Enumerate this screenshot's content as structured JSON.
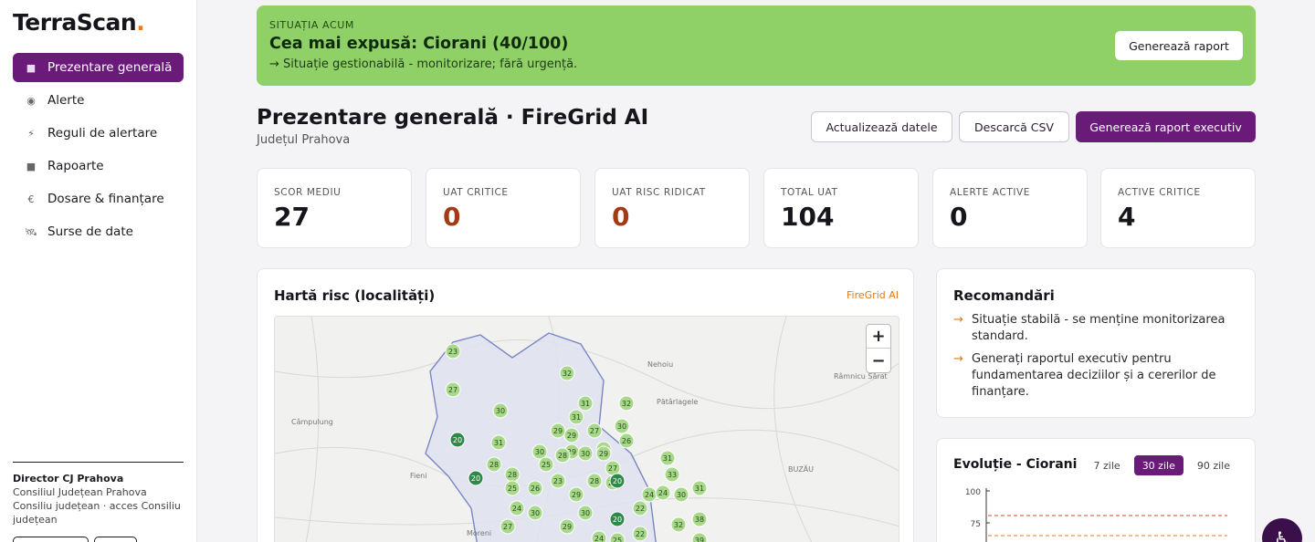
{
  "brand": {
    "name": "TerraScan",
    "dot": "."
  },
  "sidebar": {
    "items": [
      {
        "label": "Prezentare generală",
        "icon": "square-icon",
        "glyph": "■",
        "active": true
      },
      {
        "label": "Alerte",
        "icon": "alert-dot-icon",
        "glyph": "◉",
        "active": false
      },
      {
        "label": "Reguli de alertare",
        "icon": "bolt-icon",
        "glyph": "⚡",
        "active": false
      },
      {
        "label": "Rapoarte",
        "icon": "report-icon",
        "glyph": "■",
        "active": false
      },
      {
        "label": "Dosare & finanțare",
        "icon": "euro-icon",
        "glyph": "€",
        "active": false
      },
      {
        "label": "Surse de date",
        "icon": "satellite-icon",
        "glyph": "🛰",
        "active": false
      }
    ],
    "user": {
      "name": "Director CJ Prahova",
      "org": "Consiliul Județean Prahova",
      "role": "Consiliu județean · acces Consiliu județean"
    }
  },
  "banner": {
    "label": "SITUAȚIA ACUM",
    "headline": "Cea mai expusă: Ciorani (40/100)",
    "sub": "→ Situație gestionabilă - monitorizare; fără urgență.",
    "button": "Generează raport",
    "color": "#8fd166"
  },
  "header": {
    "title": "Prezentare generală · FireGrid AI",
    "subtitle": "Județul Prahova",
    "buttons": {
      "refresh": "Actualizează datele",
      "csv": "Descarcă CSV",
      "exec": "Generează raport executiv"
    }
  },
  "kpis": [
    {
      "label": "SCOR MEDIU",
      "value": "27",
      "danger": false
    },
    {
      "label": "UAT CRITICE",
      "value": "0",
      "danger": true
    },
    {
      "label": "UAT RISC RIDICAT",
      "value": "0",
      "danger": true
    },
    {
      "label": "TOTAL UAT",
      "value": "104",
      "danger": false
    },
    {
      "label": "ALERTE ACTIVE",
      "value": "0",
      "danger": false
    },
    {
      "label": "ACTIVE CRITICE",
      "value": "4",
      "danger": false
    }
  ],
  "map": {
    "title": "Hartă risc (localități)",
    "tag": "FireGrid AI",
    "zoom_in": "+",
    "zoom_out": "−",
    "place_labels": [
      "Nehoiu",
      "Râmnicu Sărat",
      "Pătârlagele",
      "Câmpulung",
      "BUZĂU",
      "Fieni",
      "Moreni"
    ],
    "markers": [
      "23",
      "27",
      "30",
      "32",
      "31",
      "32",
      "31",
      "30",
      "29",
      "29",
      "27",
      "26",
      "31",
      "25",
      "30",
      "29",
      "28",
      "30",
      "29",
      "31",
      "27",
      "25",
      "33",
      "28",
      "28",
      "27",
      "23",
      "28",
      "26",
      "25",
      "24",
      "30",
      "29",
      "30",
      "24",
      "24",
      "30",
      "31",
      "22",
      "32",
      "38",
      "29",
      "20",
      "22",
      "27",
      "24",
      "25",
      "39",
      "20",
      "20",
      "20"
    ]
  },
  "recommendations": {
    "title": "Recomandări",
    "items": [
      "Situație stabilă - se menține monitorizarea standard.",
      "Generați raportul executiv pentru fundamentarea deciziilor și a cererilor de finanțare."
    ]
  },
  "evolution": {
    "title": "Evoluție - Ciorani",
    "tabs": [
      "7 zile",
      "30 zile",
      "90 zile"
    ],
    "active_tab": 1,
    "y_ticks": [
      "100",
      "75"
    ]
  },
  "fab": {
    "glyph": "♿"
  },
  "colors": {
    "accent": "#6a1b7a",
    "orange": "#e07a1a",
    "danger": "#a23a16",
    "marker_light": "#a8d98a",
    "marker_dark": "#2f8a4a"
  }
}
